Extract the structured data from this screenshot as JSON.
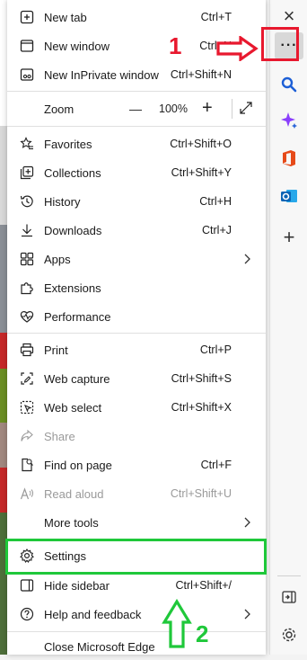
{
  "menu": {
    "new_tab": {
      "label": "New tab",
      "shortcut": "Ctrl+T"
    },
    "new_window": {
      "label": "New window",
      "shortcut": "Ctrl+N"
    },
    "new_inprivate": {
      "label": "New InPrivate window",
      "shortcut": "Ctrl+Shift+N"
    },
    "zoom": {
      "label": "Zoom",
      "minus": "—",
      "value": "100%",
      "plus": "+"
    },
    "favorites": {
      "label": "Favorites",
      "shortcut": "Ctrl+Shift+O"
    },
    "collections": {
      "label": "Collections",
      "shortcut": "Ctrl+Shift+Y"
    },
    "history": {
      "label": "History",
      "shortcut": "Ctrl+H"
    },
    "downloads": {
      "label": "Downloads",
      "shortcut": "Ctrl+J"
    },
    "apps": {
      "label": "Apps"
    },
    "extensions": {
      "label": "Extensions"
    },
    "performance": {
      "label": "Performance"
    },
    "print": {
      "label": "Print",
      "shortcut": "Ctrl+P"
    },
    "web_capture": {
      "label": "Web capture",
      "shortcut": "Ctrl+Shift+S"
    },
    "web_select": {
      "label": "Web select",
      "shortcut": "Ctrl+Shift+X"
    },
    "share": {
      "label": "Share"
    },
    "find_on_page": {
      "label": "Find on page",
      "shortcut": "Ctrl+F"
    },
    "read_aloud": {
      "label": "Read aloud",
      "shortcut": "Ctrl+Shift+U"
    },
    "more_tools": {
      "label": "More tools"
    },
    "settings": {
      "label": "Settings"
    },
    "hide_sidebar": {
      "label": "Hide sidebar",
      "shortcut": "Ctrl+Shift+/"
    },
    "help": {
      "label": "Help and feedback"
    },
    "close_edge": {
      "label": "Close Microsoft Edge"
    }
  },
  "sidebar": {
    "close": "×",
    "more": "···",
    "add": "+"
  },
  "annotations": {
    "step1": "1",
    "step2": "2"
  },
  "colors": {
    "annotation_red": "#e8182e",
    "annotation_green": "#1fc83a",
    "copilot_blue": "#2b66d8"
  }
}
